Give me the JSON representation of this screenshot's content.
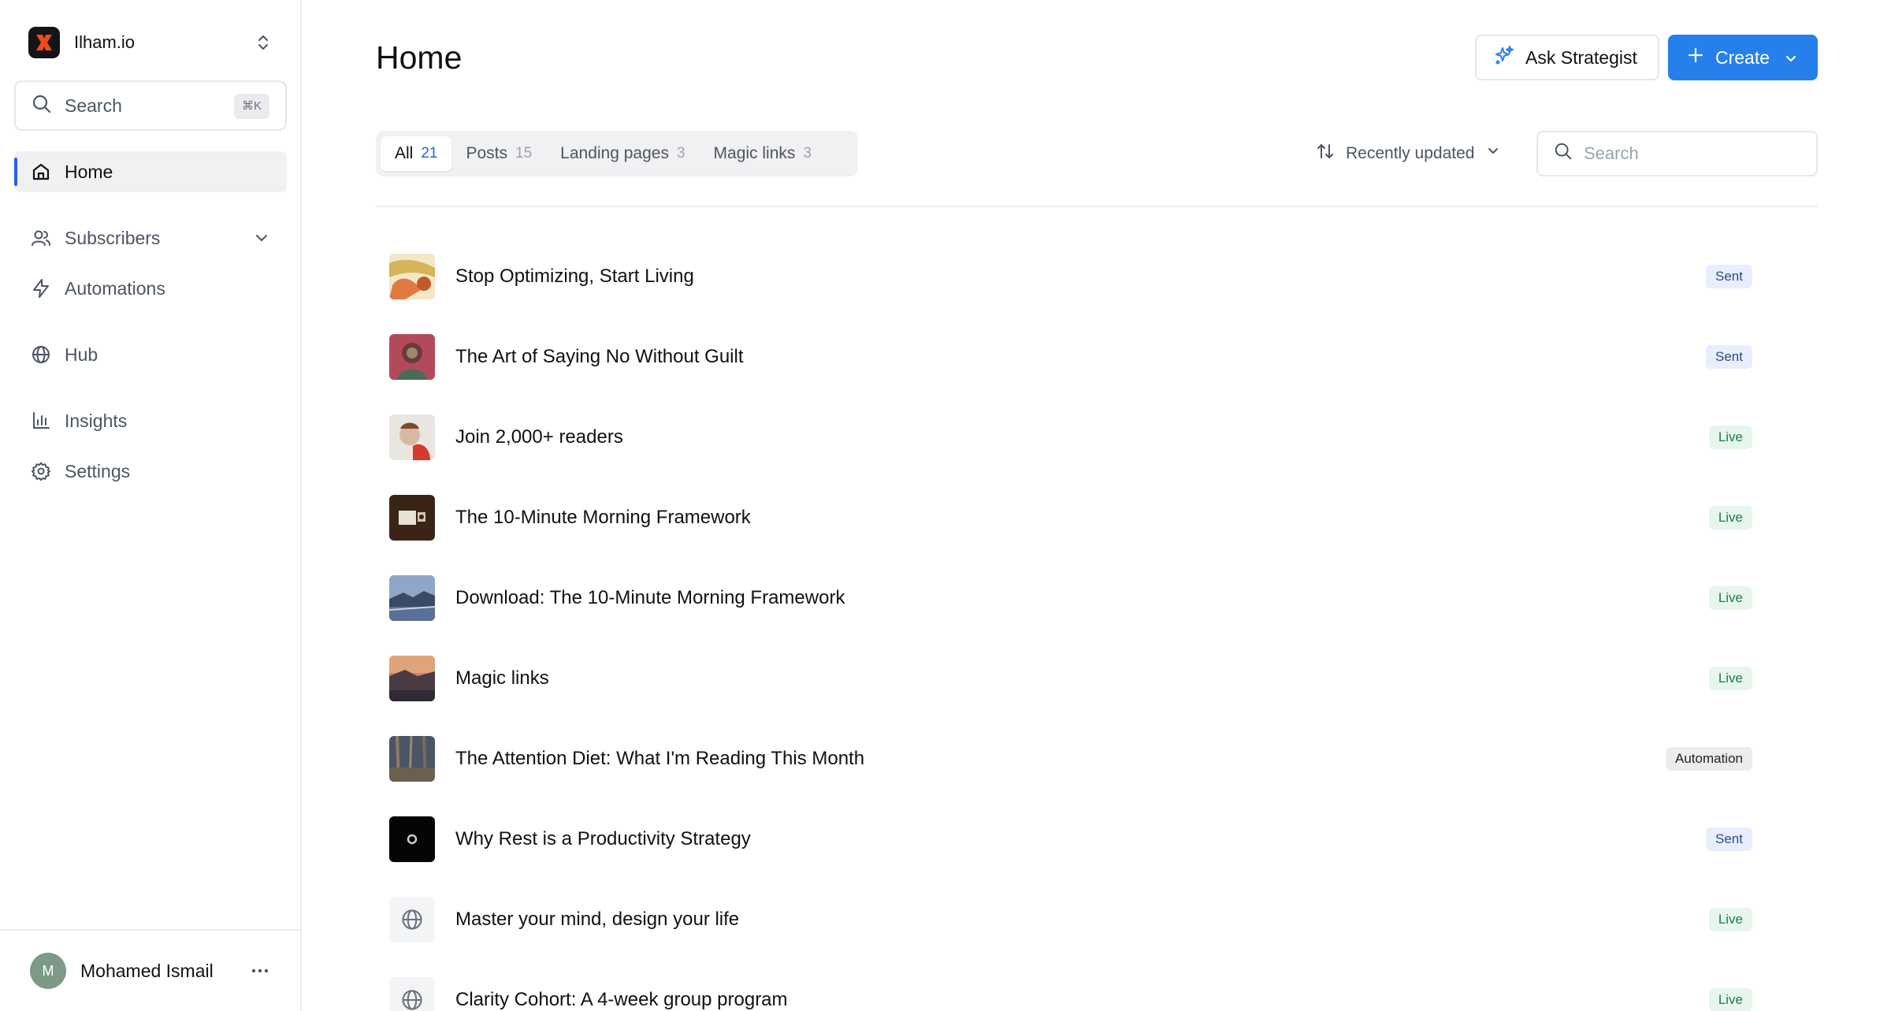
{
  "sidebar": {
    "workspace_name": "Ilham.io",
    "search_label": "Search",
    "search_shortcut": "⌘K",
    "items": [
      {
        "label": "Home"
      },
      {
        "label": "Subscribers"
      },
      {
        "label": "Automations"
      },
      {
        "label": "Hub"
      },
      {
        "label": "Insights"
      },
      {
        "label": "Settings"
      }
    ],
    "user": {
      "initial": "M",
      "name": "Mohamed Ismail"
    }
  },
  "header": {
    "title": "Home",
    "ask_label": "Ask Strategist",
    "create_label": "Create"
  },
  "tabs": [
    {
      "label": "All",
      "count": "21"
    },
    {
      "label": "Posts",
      "count": "15"
    },
    {
      "label": "Landing pages",
      "count": "3"
    },
    {
      "label": "Magic links",
      "count": "3"
    }
  ],
  "sort_label": "Recently updated",
  "search_placeholder": "Search",
  "items": [
    {
      "title": "Stop Optimizing, Start Living",
      "status": "Sent"
    },
    {
      "title": "The Art of Saying No Without Guilt",
      "status": "Sent"
    },
    {
      "title": "Join 2,000+ readers",
      "status": "Live"
    },
    {
      "title": "The 10-Minute Morning Framework",
      "status": "Live"
    },
    {
      "title": "Download: The 10-Minute Morning Framework",
      "status": "Live"
    },
    {
      "title": "Magic links",
      "status": "Live"
    },
    {
      "title": "The Attention Diet: What I'm Reading This Month",
      "status": "Automation"
    },
    {
      "title": "Why Rest is a Productivity Strategy",
      "status": "Sent"
    },
    {
      "title": "Master your mind, design your life",
      "status": "Live"
    },
    {
      "title": "Clarity Cohort: A 4-week group program",
      "status": "Live"
    }
  ],
  "colors": {
    "accent": "#2680eb",
    "sent_badge_bg": "#e8eefb",
    "live_badge_bg": "#e6f6ec",
    "automation_badge_bg": "#ececee"
  }
}
